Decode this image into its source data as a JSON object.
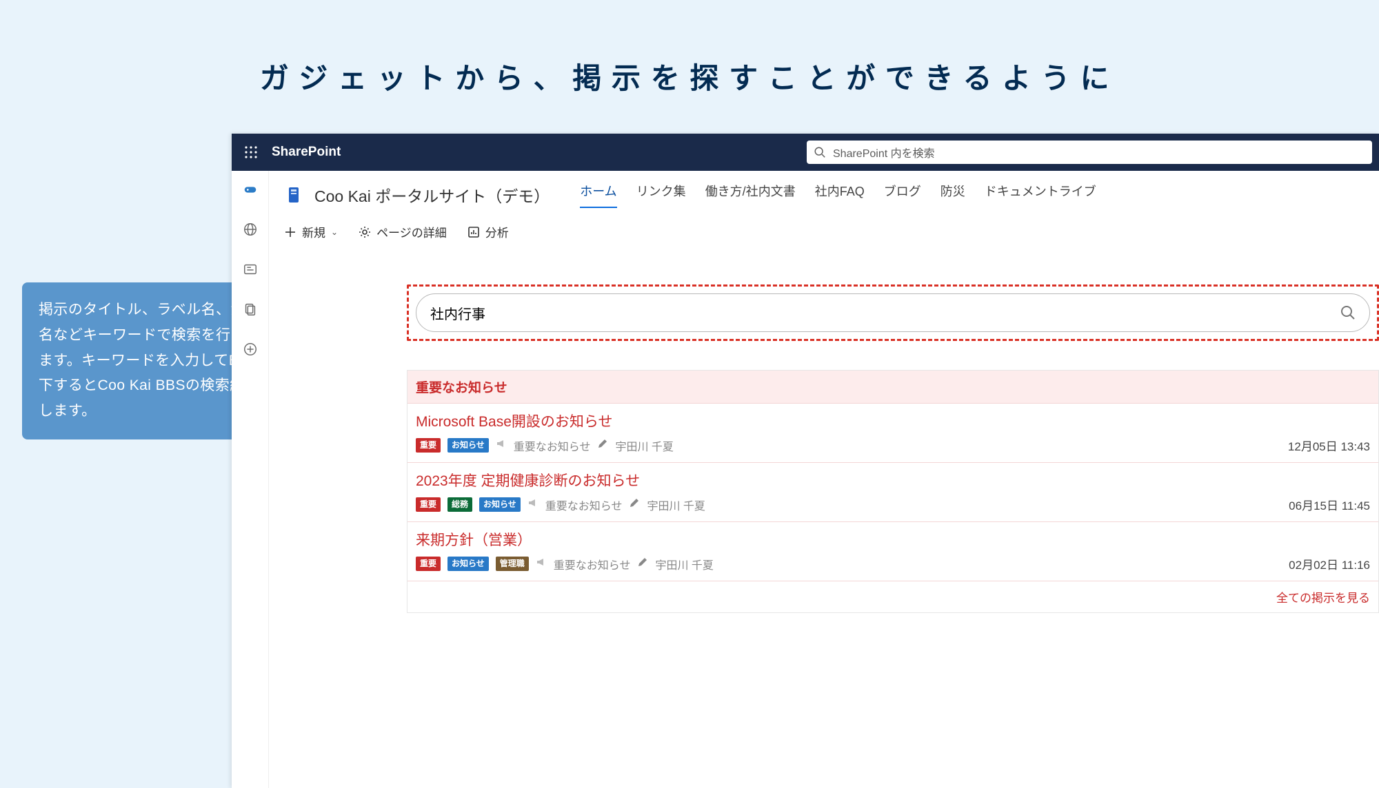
{
  "page": {
    "heading": "ガジェットから、掲示を探すことができるように"
  },
  "callout": {
    "text": "掲示のタイトル、ラベル名、添付ファイル名などキーワードで検索を行うことができます。キーワードを入力してEnterキーを押下するとCoo Kai BBSの検索結果画面に遷移します。"
  },
  "topbar": {
    "product": "SharePoint",
    "search_placeholder": "SharePoint 内を検索"
  },
  "site": {
    "name": "Coo Kai ポータルサイト（デモ）",
    "tabs": {
      "home": "ホーム",
      "links": "リンク集",
      "workdocs": "働き方/社内文書",
      "faq": "社内FAQ",
      "blog": "ブログ",
      "disaster": "防災",
      "doclib": "ドキュメントライブ"
    }
  },
  "commands": {
    "new": "新規",
    "pagedetail": "ページの詳細",
    "analytics": "分析"
  },
  "gadget_search": {
    "value": "社内行事"
  },
  "announcements": {
    "header": "重要なお知らせ",
    "view_all": "全ての掲示を見る",
    "category_label": "重要なお知らせ",
    "tag_labels": {
      "important": "重要",
      "notice": "お知らせ",
      "general": "総務",
      "manager": "管理職"
    },
    "items": [
      {
        "title": "Microsoft Base開設のお知らせ",
        "tags": [
          "important",
          "notice"
        ],
        "author": "宇田川 千夏",
        "time": "12月05日 13:43"
      },
      {
        "title": "2023年度 定期健康診断のお知らせ",
        "tags": [
          "important",
          "general",
          "notice"
        ],
        "author": "宇田川 千夏",
        "time": "06月15日 11:45"
      },
      {
        "title": "来期方針（営業）",
        "tags": [
          "important",
          "notice",
          "manager"
        ],
        "author": "宇田川 千夏",
        "time": "02月02日 11:16"
      }
    ]
  }
}
